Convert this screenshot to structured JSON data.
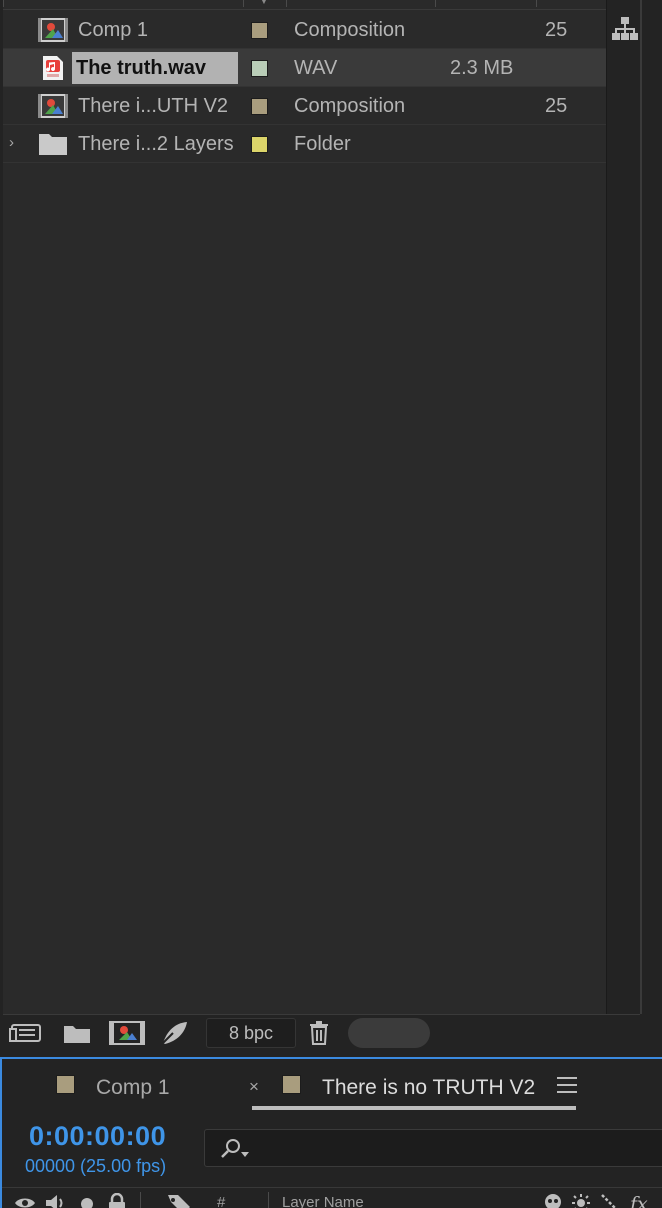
{
  "project": {
    "items": [
      {
        "name": "Comp 1",
        "icon": "composition-icon",
        "label_color": "#a99d7e",
        "type": "Composition",
        "size": "",
        "fps": "25",
        "selected": false,
        "has_twirl": false
      },
      {
        "name": "The truth.wav",
        "icon": "audio-file-icon",
        "label_color": "#b9cdb7",
        "type": "WAV",
        "size": "2.3 MB",
        "fps": "",
        "selected": true,
        "has_twirl": false
      },
      {
        "name": "There i...UTH V2",
        "icon": "composition-icon",
        "label_color": "#a99d7e",
        "type": "Composition",
        "size": "",
        "fps": "25",
        "selected": false,
        "has_twirl": false
      },
      {
        "name": "There i...2 Layers",
        "icon": "folder-icon",
        "label_color": "#dcd56a",
        "type": "Folder",
        "size": "",
        "fps": "",
        "selected": false,
        "has_twirl": true
      }
    ],
    "bit_depth": "8 bpc"
  },
  "timeline": {
    "tabs": [
      {
        "label": "Comp 1",
        "color": "#a99d7e",
        "active": false
      },
      {
        "label": "There is no TRUTH V2",
        "color": "#a99d7e",
        "active": true
      }
    ],
    "close_glyph": "×",
    "timecode": "0:00:00:00",
    "frames": "00000 (25.00 fps)",
    "columns": {
      "number": "#",
      "layer_name": "Layer Name"
    }
  }
}
